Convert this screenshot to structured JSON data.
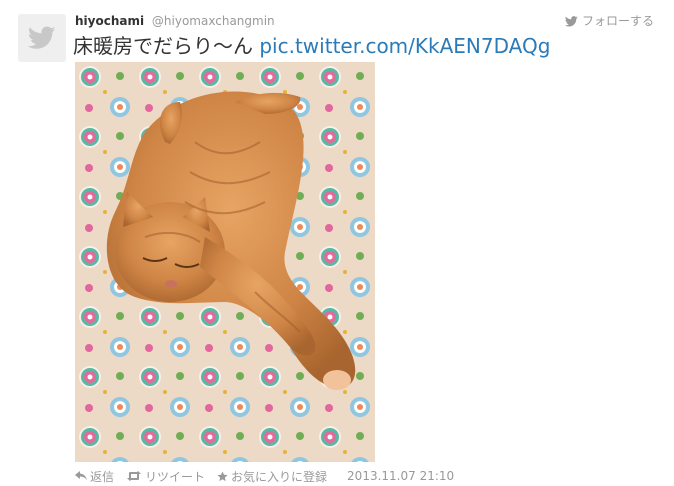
{
  "tweet": {
    "display_name": "hiyochami",
    "handle": "@hiyomaxchangmin",
    "follow_label": "フォローする",
    "text": "床暖房でだらり〜ん ",
    "link_text": "pic.twitter.com/KkAEN7DAQg",
    "timestamp": "2013.11.07 21:10"
  },
  "actions": {
    "reply_label": "返信",
    "retweet_label": "リツイート",
    "favorite_label": "お気に入りに登録"
  },
  "icons": {
    "avatar": "twitter-bird-icon",
    "follow": "twitter-bird-icon",
    "reply": "reply-arrow-icon",
    "retweet": "retweet-icon",
    "favorite": "star-icon"
  },
  "colors": {
    "link": "#2b7bb9",
    "muted": "#999999",
    "avatar_bg": "#efefef"
  }
}
